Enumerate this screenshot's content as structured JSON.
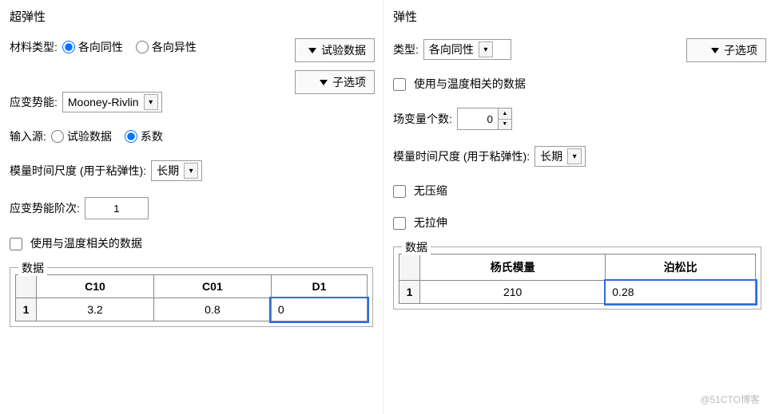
{
  "left": {
    "title": "超弹性",
    "material_type_label": "材料类型:",
    "radio_isotropic": "各向同性",
    "radio_anisotropic": "各向异性",
    "test_data_btn": "试验数据",
    "suboptions_btn": "子选项",
    "strain_energy_label": "应变势能:",
    "strain_energy_value": "Mooney-Rivlin",
    "input_source_label": "输入源:",
    "radio_test_data": "试验数据",
    "radio_coefficients": "系数",
    "module_time_label": "模量时间尺度 (用于粘弹性):",
    "module_time_value": "长期",
    "strain_order_label": "应变势能阶次:",
    "strain_order_value": "1",
    "temp_checkbox_label": "使用与温度相关的数据",
    "data_legend": "数据",
    "table": {
      "headers": [
        "C10",
        "C01",
        "D1"
      ],
      "row_index": "1",
      "cells": [
        "3.2",
        "0.8",
        "0"
      ]
    }
  },
  "right": {
    "title": "弹性",
    "type_label": "类型:",
    "type_value": "各向同性",
    "suboptions_btn": "子选项",
    "temp_checkbox_label": "使用与温度相关的数据",
    "field_var_label": "场变量个数:",
    "field_var_value": "0",
    "module_time_label": "模量时间尺度 (用于粘弹性):",
    "module_time_value": "长期",
    "no_compression_label": "无压缩",
    "no_tension_label": "无拉伸",
    "data_legend": "数据",
    "table": {
      "headers": [
        "杨氏模量",
        "泊松比"
      ],
      "row_index": "1",
      "cells": [
        "210",
        "0.28"
      ]
    }
  },
  "watermark": "@51CTO博客"
}
